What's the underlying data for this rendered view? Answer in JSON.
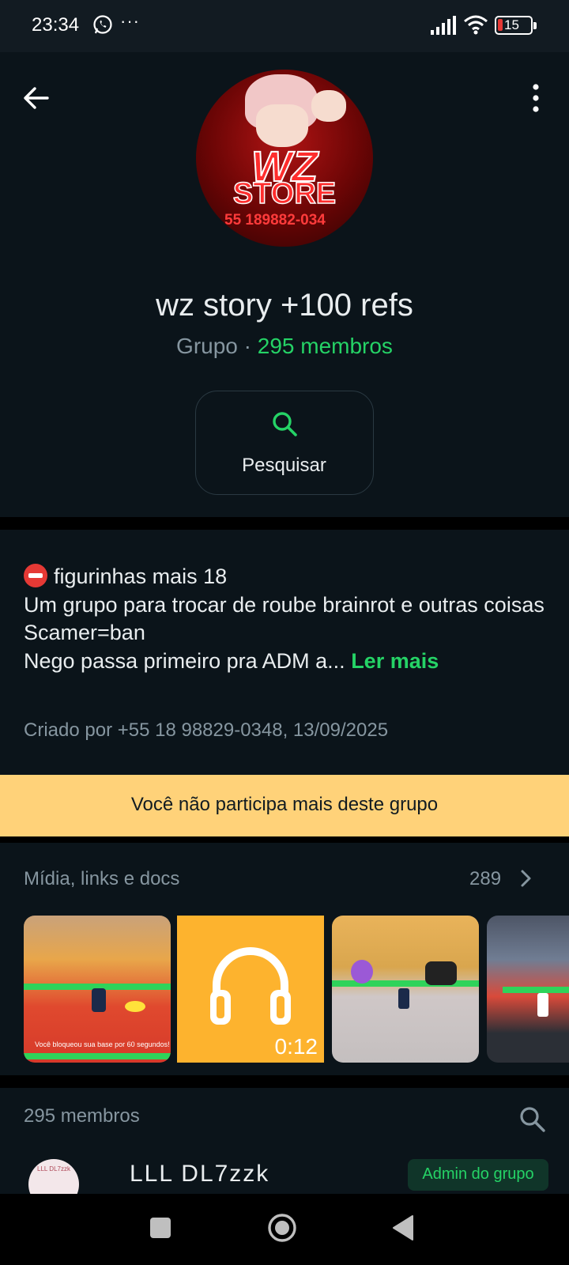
{
  "status_bar": {
    "time": "23:34",
    "notification_icon": "whatsapp-icon",
    "more_indicator": "···",
    "battery": "15",
    "icons": [
      "signal-icon",
      "wifi-icon",
      "battery-icon"
    ]
  },
  "header": {
    "back_icon": "arrow-left-icon",
    "menu_icon": "more-vertical-icon",
    "avatar_logo_text": [
      "WZ",
      "STORE",
      "55 189882-034"
    ],
    "group_name": "wz story +100 refs",
    "group_type": "Grupo · ",
    "member_count_label": "295 membros",
    "search_label": "Pesquisar"
  },
  "description": {
    "lines": [
      "figurinhas mais 18",
      "Um grupo para trocar de roube brainrot e outras coisas",
      "Scamer=ban",
      "Nego passa primeiro pra ADM a... "
    ],
    "read_more": "Ler mais",
    "created_by": "Criado por +55 18 98829-0348, 13/09/2025"
  },
  "banner": {
    "text": "Você não participa mais deste grupo"
  },
  "media": {
    "title": "Mídia, links e docs",
    "count": "289",
    "thumbnails": [
      {
        "type": "image",
        "caption": "Você bloqueou sua base por 60 segundos!"
      },
      {
        "type": "audio",
        "duration": "0:12"
      },
      {
        "type": "image"
      },
      {
        "type": "image"
      }
    ]
  },
  "members": {
    "title": "295 membros",
    "first_member": {
      "avatar_text": "LLL DL7zzk",
      "name": "LLL DL7zzk",
      "badge": "Admin do grupo"
    }
  },
  "colors": {
    "accent": "#25d366",
    "background": "#0b141a",
    "banner": "#ffd279"
  }
}
